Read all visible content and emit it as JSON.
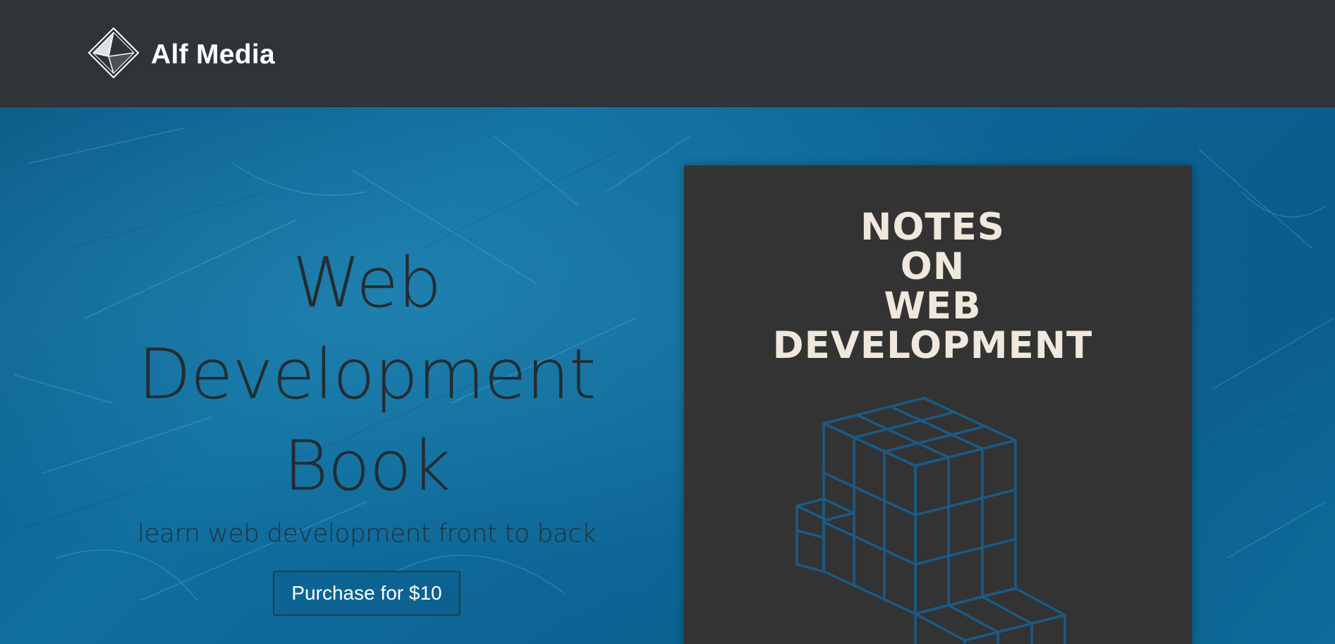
{
  "navbar": {
    "brand_name": "Alf Media",
    "logo_icon": "diamond-logo-icon",
    "background": "#2f3438"
  },
  "hero": {
    "title": "Web Development Book",
    "subtitle": "learn web development front to back",
    "purchase_label": "Purchase for $10",
    "background": "#0d6a98"
  },
  "book": {
    "title_lines": [
      "NOTES",
      "ON",
      "WEB",
      "DEVELOPMENT"
    ],
    "cover_color": "#333333",
    "title_color": "#f0e8dc",
    "art_icon": "cube-stack-icon",
    "art_color": "#1a5a86"
  }
}
